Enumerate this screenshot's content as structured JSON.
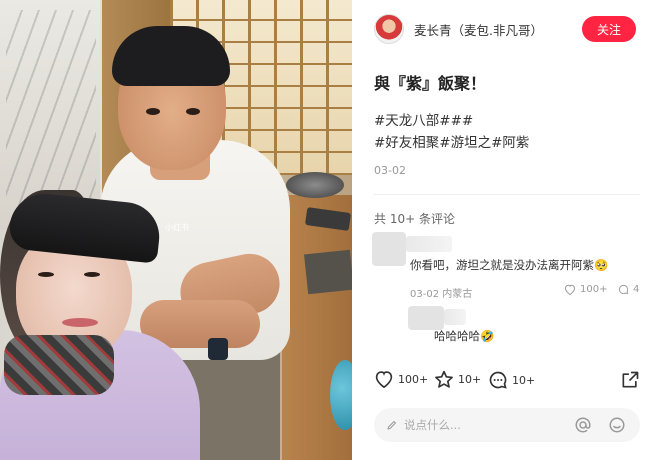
{
  "author": {
    "name": "麦长青（麦包.非凡哥）",
    "follow_label": "关注",
    "accent": "#ff2442"
  },
  "post": {
    "title": "與『紫』飯聚！",
    "tags": [
      "#天龙八部###",
      "#好友相聚#游坦之#阿紫"
    ],
    "date": "03-02",
    "photo_watermark": "小红书"
  },
  "comments_section": {
    "count_label": "共 10+ 条评论"
  },
  "comments": [
    {
      "text": "你看吧，游坦之就是没办法离开阿紫🥺",
      "date": "03-02 内蒙古",
      "likes": "100+",
      "replies": "4"
    },
    {
      "text": "哈哈哈哈🤣"
    }
  ],
  "actions": {
    "likes": "100+",
    "favorites": "10+",
    "comments": "10+"
  },
  "input": {
    "placeholder": "说点什么..."
  },
  "icons": [
    "heart-icon",
    "star-icon",
    "comment-icon",
    "share-icon",
    "pencil-icon",
    "at-icon",
    "emoji-icon"
  ]
}
